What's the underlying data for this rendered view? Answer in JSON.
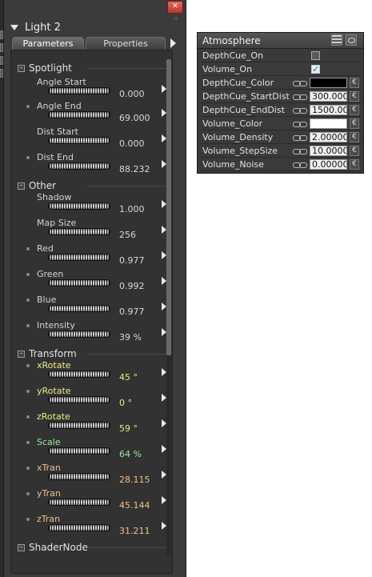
{
  "light_panel": {
    "title": "Light 2",
    "close_glyph": "✕",
    "tabs": [
      "Parameters",
      "Properties"
    ],
    "groups": {
      "spotlight": "Spotlight",
      "other": "Other",
      "transform": "Transform",
      "shadernode": "ShaderNode"
    },
    "params": [
      {
        "label": "Angle Start",
        "value": "0.000",
        "style": "white"
      },
      {
        "label": "Angle End",
        "value": "69.000",
        "style": "white"
      },
      {
        "label": "Dist Start",
        "value": "0.000",
        "style": "white"
      },
      {
        "label": "Dist End",
        "value": "88.232",
        "style": "white"
      },
      {
        "label": "Shadow",
        "value": "1.000",
        "style": "white"
      },
      {
        "label": "Map Size",
        "value": "256",
        "style": "white"
      },
      {
        "label": "Red",
        "value": "0.977",
        "style": "white"
      },
      {
        "label": "Green",
        "value": "0.992",
        "style": "white"
      },
      {
        "label": "Blue",
        "value": "0.977",
        "style": "white"
      },
      {
        "label": "Intensity",
        "value": "39 %",
        "style": "white"
      },
      {
        "label": "xRotate",
        "value": "45 °",
        "style": "yellow"
      },
      {
        "label": "yRotate",
        "value": "0 °",
        "style": "yellow"
      },
      {
        "label": "zRotate",
        "value": "59 °",
        "style": "yellow"
      },
      {
        "label": "Scale",
        "value": "64 %",
        "style": "green"
      },
      {
        "label": "xTran",
        "value": "28.115",
        "style": "orange"
      },
      {
        "label": "yTran",
        "value": "45.144",
        "style": "orange"
      },
      {
        "label": "zTran",
        "value": "31.211",
        "style": "orange"
      }
    ]
  },
  "atmosphere": {
    "title": "Atmosphere",
    "rows": [
      {
        "label": "DepthCue_On",
        "kind": "checkbox",
        "checked": false
      },
      {
        "label": "Volume_On",
        "kind": "checkbox",
        "checked": true
      },
      {
        "label": "DepthCue_Color",
        "kind": "color",
        "color": "#000000"
      },
      {
        "label": "DepthCue_StartDist",
        "kind": "number",
        "value": "300.0000"
      },
      {
        "label": "DepthCue_EndDist",
        "kind": "number",
        "value": "1500.0000"
      },
      {
        "label": "Volume_Color",
        "kind": "color",
        "color": "#ffffff"
      },
      {
        "label": "Volume_Density",
        "kind": "number",
        "value": "2.000000"
      },
      {
        "label": "Volume_StepSize",
        "kind": "number",
        "value": "10.00000"
      },
      {
        "label": "Volume_Noise",
        "kind": "number",
        "value": "0.000000"
      }
    ],
    "checkmark_glyph": "✓",
    "row_button_glyph": "€"
  }
}
